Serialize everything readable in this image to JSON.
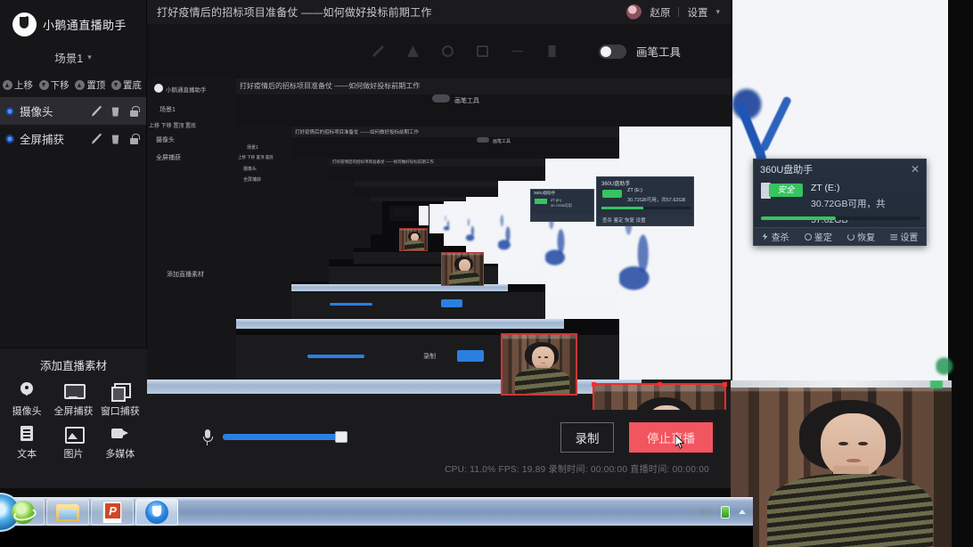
{
  "app": {
    "brand": "小鹅通直播助手",
    "logo_icon": "goose-logo-icon"
  },
  "titlebar": {
    "title": "打好疫情后的招标项目准备仗 ——如何做好投标前期工作",
    "user_name": "赵原",
    "avatar_icon": "user-avatar",
    "settings_label": "设置",
    "chevron_icon": "chevron-down-icon"
  },
  "toolbar": {
    "brush_toggle_label": "画笔工具",
    "brush_toggle_state": "off",
    "pen_tool_icons": [
      "pen-icon",
      "triangle-icon",
      "circle-icon",
      "square-icon",
      "line-icon",
      "eraser-icon"
    ]
  },
  "sidebar": {
    "scene_label": "场景1",
    "scene_chevron_icon": "chevron-down-icon",
    "order_buttons": [
      {
        "label": "上移",
        "icon": "move-up-icon"
      },
      {
        "label": "下移",
        "icon": "move-down-icon"
      },
      {
        "label": "置顶",
        "icon": "move-top-icon"
      },
      {
        "label": "置底",
        "icon": "move-bottom-icon"
      }
    ],
    "layers": [
      {
        "name": "摄像头",
        "active": true,
        "visibility_icon": "eye-icon",
        "edit_icon": "pencil-icon",
        "delete_icon": "trash-icon",
        "lock_icon": "unlock-icon"
      },
      {
        "name": "全屏捕获",
        "active": false,
        "visibility_icon": "eye-icon",
        "edit_icon": "pencil-icon",
        "delete_icon": "trash-icon",
        "lock_icon": "unlock-icon"
      }
    ],
    "add_panel": {
      "title": "添加直播素材",
      "items": [
        {
          "label": "摄像头",
          "icon": "camera-icon"
        },
        {
          "label": "全屏捕获",
          "icon": "display-capture-icon"
        },
        {
          "label": "窗口捕获",
          "icon": "window-capture-icon"
        },
        {
          "label": "文本",
          "icon": "text-icon"
        },
        {
          "label": "图片",
          "icon": "image-icon"
        },
        {
          "label": "多媒体",
          "icon": "media-icon"
        }
      ]
    }
  },
  "bottombar": {
    "mic_icon": "microphone-icon",
    "mic_volume_percent": 92,
    "record_button": "录制",
    "stop_live_button": "停止直播",
    "cursor_icon": "mouse-pointer-icon",
    "status": "CPU: 11.0%   FPS: 19.89   录制时间: 00:00:00   直播时间: 00:00:00"
  },
  "popup360": {
    "title": "360U盘助手",
    "close_icon": "close-icon",
    "badge": "安全",
    "usb_icon": "usb-drive-icon",
    "drive_name": "ZT (E:)",
    "capacity": "30.72GB可用，共57.62GB",
    "usage_percent": 47,
    "actions": [
      {
        "label": "查杀",
        "icon": "bolt-icon"
      },
      {
        "label": "鉴定",
        "icon": "magnify-icon"
      },
      {
        "label": "恢复",
        "icon": "undo-icon"
      },
      {
        "label": "设置",
        "icon": "gear-icon"
      }
    ]
  },
  "taskbar": {
    "start_icon": "windows-start-orb",
    "items": [
      {
        "icon": "internet-explorer-icon",
        "active": false
      },
      {
        "icon": "folder-explorer-icon",
        "active": false
      },
      {
        "icon": "powerpoint-icon",
        "active": false
      },
      {
        "icon": "live-assistant-icon",
        "active": true
      }
    ],
    "tray": [
      {
        "icon": "keyboard-icon"
      },
      {
        "icon": "battery-icon"
      },
      {
        "icon": "show-hidden-icons-arrow"
      }
    ]
  },
  "canvas": {
    "preview_name": "live-preview-canvas",
    "webcam_source_name": "摄像头",
    "screen_source_name": "全屏捕获",
    "selection_handles": 8
  }
}
